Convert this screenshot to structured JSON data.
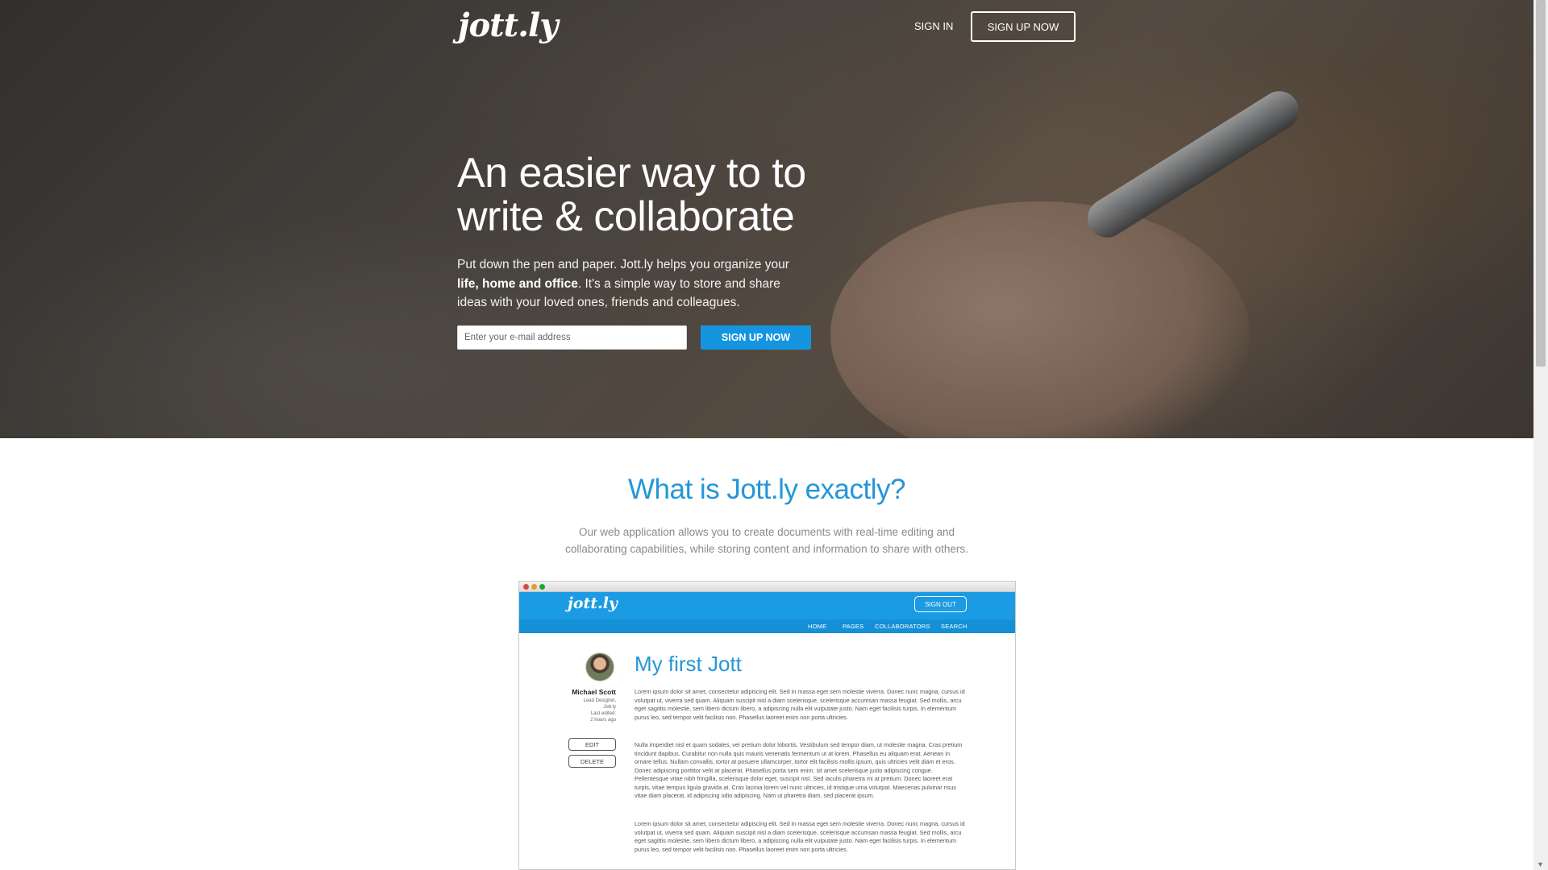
{
  "header": {
    "logo": "jott.ly",
    "signin_label": "SIGN IN",
    "signup_label": "SIGN UP NOW"
  },
  "hero": {
    "title_line1": "An easier way to to",
    "title_line2": "write & collaborate",
    "sub_part1": "Put down the pen and paper. Jott.ly helps you organize your ",
    "sub_bold": "life, home and office",
    "sub_part2": ". It's a simple way to store and share ideas with your loved ones, friends and colleagues.",
    "email_placeholder": "Enter your e-mail address",
    "cta_label": "SIGN UP NOW"
  },
  "about": {
    "title": "What is Jott.ly exactly?",
    "description": "Our web application allows you to create documents with real-time editing and collaborating capabilities, while storing content and information to share with others."
  },
  "mockup": {
    "logo": "jott.ly",
    "signout_label": "SIGN OUT",
    "nav": [
      "HOME",
      "PAGES",
      "COLLABORATORS",
      "SEARCH"
    ],
    "author_name": "Michael Scott",
    "author_role": "Lead Designer,",
    "author_company": "Jott.ly",
    "last_edited_label": "Last edited:",
    "last_edited_value": "2 hours ago",
    "edit_label": "EDIT",
    "delete_label": "DELETE",
    "doc_title": "My first Jott",
    "paragraphs": [
      "Lorem ipsum dolor sit amet, consectetur adipiscing elit. Sed in massa eget sem molestie viverra. Donec nunc magna, cursus id volutpat ut, viverra sed quam. Aliquam suscipit nisl a diam scelerisque, scelerisque accumsan massa feugiat. Sed mollis, arcu eget sagittis molestie, sem libero dictum libero, a adipiscing nulla elit vulputate justo. Nam eget facilisis turpis. In elementum purus leo, sed tempor velit facilisis non. Phasellus laoreet enim non porta ultricies.",
      "Nulla imperdiet nisl et quam sodales, vel pretium dolor lobortis. Vestibulum sed tempor diam, ut molestie magna. Cras pretium tincidunt dapibus. Curabitur non nulla quis mauris venenatis fermentum ut at lorem. Phasellus eu aliquam erat. Aenean in ornare tellus. Nullam convallis, tortor at posuere ullamcorper, tortor elit facilisis mollis ipsum, quis ultricies velit diam et eros. Donec adipiscing porttitor velit at placerat. Phasellus porta sem enim, sit amet scelerisque justo adipiscing congue. Pellentesque vitae nibh fringilla, scelerisque dolor eget, suscipit nisl. Sed iaculis pharetra mi at pretium. Donec laoreet erat turpis, vitae tempus ligula gravida at. Cras lacinia lorem vel nunc ultricies, id tristique urna volutpat. Maecenas pulvinar risus vitae diam placerat, id adipiscing odio adipiscing. Nam ut pharetra diam, sed placerat ipsum.",
      "Lorem ipsum dolor sit amet, consectetur adipiscing elit. Sed in massa eget sem molestie viverra. Donec nunc magna, cursus id volutpat ut, viverra sed quam. Aliquam suscipit nisl a diam scelerisque, scelerisque accumsan massa feugiat. Sed mollis, arcu eget sagittis molestie, sem libero dictum libero, a adipiscing nulla elit vulputate justo. Nam eget facilisis turpis. In elementum purus leo, sed tempor velit facilisis non. Phasellus laoreet enim non porta ultricies."
    ]
  },
  "colors": {
    "accent": "#1595e0",
    "heading_blue": "#2596d8",
    "body_gray": "#8a8a8a"
  },
  "icons": {
    "window_close": "red-dot",
    "window_minimize": "yellow-dot",
    "window_maximize": "green-dot",
    "scroll_down": "triangle-down"
  }
}
